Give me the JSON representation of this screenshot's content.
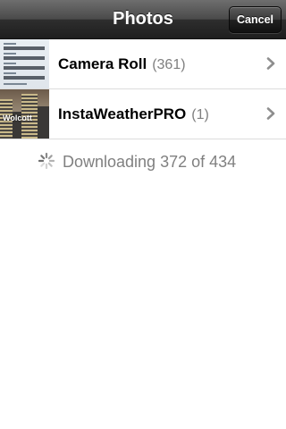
{
  "navbar": {
    "title": "Photos",
    "cancel_label": "Cancel"
  },
  "albums": [
    {
      "name": "Camera Roll",
      "count": "(361)",
      "thumbnail_icon": "camera-roll-thumbnail"
    },
    {
      "name": "InstaWeatherPRO",
      "count": "(1)",
      "thumbnail_icon": "instaweather-thumbnail",
      "thumbnail_text": "Wolcott"
    }
  ],
  "status": {
    "text": "Downloading 372 of 434",
    "icon": "spinner-icon"
  },
  "colors": {
    "navbar_dark": "#1e1e1e",
    "count_gray": "#7f7f7f",
    "status_gray": "#808080",
    "chevron_gray": "#8e8e8e",
    "separator": "#dcdcdc"
  }
}
